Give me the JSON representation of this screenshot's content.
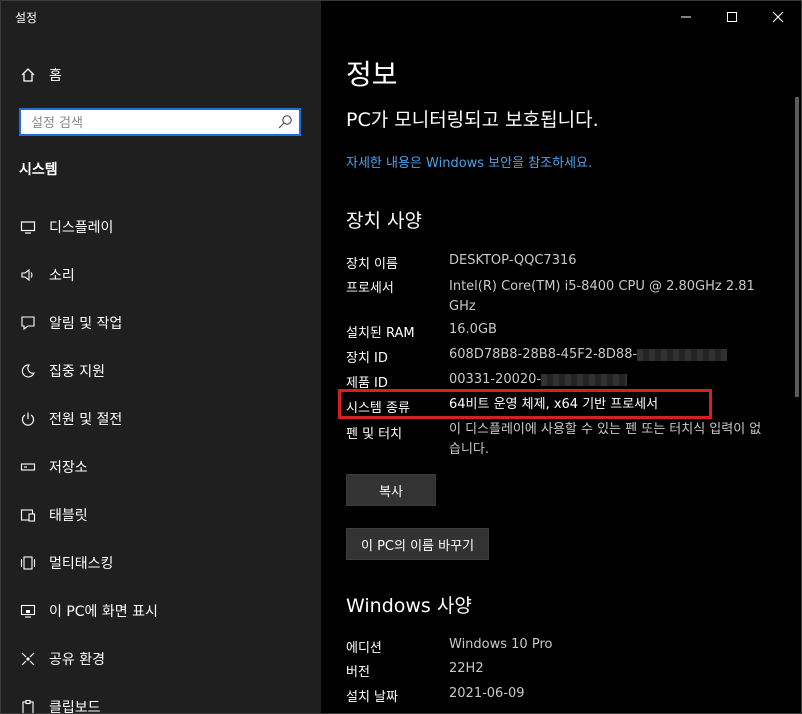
{
  "window": {
    "title": "설정"
  },
  "sidebar": {
    "home_label": "홈",
    "search_placeholder": "설정 검색",
    "section": "시스템",
    "items": [
      {
        "label": "디스플레이",
        "icon": "display-icon"
      },
      {
        "label": "소리",
        "icon": "speaker-icon"
      },
      {
        "label": "알림 및 작업",
        "icon": "notification-icon"
      },
      {
        "label": "집중 지원",
        "icon": "moon-icon"
      },
      {
        "label": "전원 및 절전",
        "icon": "power-icon"
      },
      {
        "label": "저장소",
        "icon": "storage-icon"
      },
      {
        "label": "태블릿",
        "icon": "tablet-icon"
      },
      {
        "label": "멀티태스킹",
        "icon": "multitasking-icon"
      },
      {
        "label": "이 PC에 화면 표시",
        "icon": "project-icon"
      },
      {
        "label": "공유 환경",
        "icon": "share-icon"
      },
      {
        "label": "클립보드",
        "icon": "clipboard-icon"
      }
    ]
  },
  "main": {
    "title": "정보",
    "protect_status": "PC가 모니터링되고 보호됩니다.",
    "security_link": "자세한 내용은 Windows 보안을 참조하세요.",
    "device_specs": {
      "heading": "장치 사양",
      "rows": [
        {
          "label": "장치 이름",
          "value": "DESKTOP-QQC7316"
        },
        {
          "label": "프로세서",
          "value": "Intel(R) Core(TM) i5-8400 CPU @ 2.80GHz   2.81 GHz"
        },
        {
          "label": "설치된 RAM",
          "value": "16.0GB"
        },
        {
          "label": "장치 ID",
          "value": "608D78B8-28B8-45F2-8D88-"
        },
        {
          "label": "제품 ID",
          "value": "00331-20020-"
        },
        {
          "label": "시스템 종류",
          "value": "64비트 운영 체제, x64 기반 프로세서"
        },
        {
          "label": "펜 및 터치",
          "value": "이 디스플레이에 사용할 수 있는 펜 또는 터치식 입력이 없습니다."
        }
      ],
      "copy_button": "복사",
      "rename_button": "이 PC의 이름 바꾸기"
    },
    "windows_specs": {
      "heading": "Windows 사양",
      "rows": [
        {
          "label": "에디션",
          "value": "Windows 10 Pro"
        },
        {
          "label": "버전",
          "value": "22H2"
        },
        {
          "label": "설치 날짜",
          "value": "2021-06-09"
        }
      ]
    }
  },
  "colors": {
    "accent": "#1e6fd9",
    "link": "#4ca0e8",
    "highlight": "#d61f1f"
  }
}
